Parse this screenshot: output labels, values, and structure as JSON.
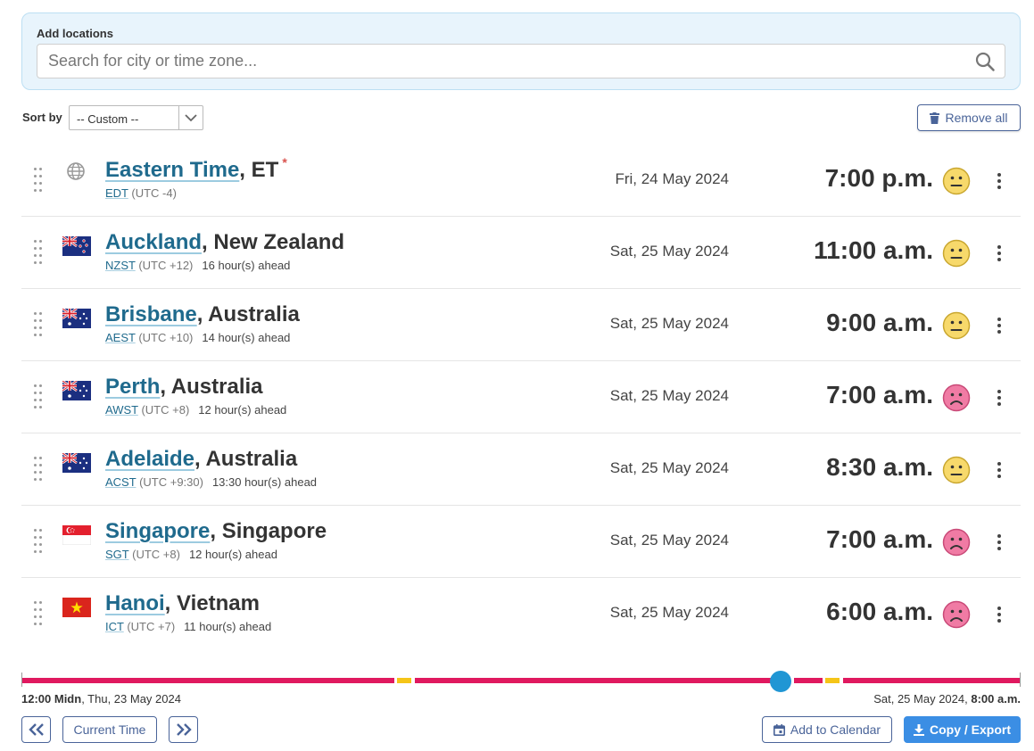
{
  "search": {
    "label": "Add locations",
    "placeholder": "Search for city or time zone...",
    "value": ""
  },
  "sort": {
    "label": "Sort by",
    "selected": "-- Custom --"
  },
  "toolbar": {
    "remove_all_label": "Remove all"
  },
  "locations": [
    {
      "city": "Eastern Time",
      "region": ", ET",
      "star": "*",
      "abbr": "EDT",
      "utc": "(UTC -4)",
      "ahead": "",
      "date": "Fri, 24 May 2024",
      "time": "7:00 p.m.",
      "mood": "neutral",
      "icon": "globe-icon"
    },
    {
      "city": "Auckland",
      "region": ", New Zealand",
      "star": "",
      "abbr": "NZST",
      "utc": "(UTC +12)",
      "ahead": "16 hour(s) ahead",
      "date": "Sat, 25 May 2024",
      "time": "11:00 a.m.",
      "mood": "neutral",
      "icon": "flag-new-zealand-icon"
    },
    {
      "city": "Brisbane",
      "region": ", Australia",
      "star": "",
      "abbr": "AEST",
      "utc": "(UTC +10)",
      "ahead": "14 hour(s) ahead",
      "date": "Sat, 25 May 2024",
      "time": "9:00 a.m.",
      "mood": "neutral",
      "icon": "flag-australia-icon"
    },
    {
      "city": "Perth",
      "region": ", Australia",
      "star": "",
      "abbr": "AWST",
      "utc": "(UTC +8)",
      "ahead": "12 hour(s) ahead",
      "date": "Sat, 25 May 2024",
      "time": "7:00 a.m.",
      "mood": "sad",
      "icon": "flag-australia-icon"
    },
    {
      "city": "Adelaide",
      "region": ", Australia",
      "star": "",
      "abbr": "ACST",
      "utc": "(UTC +9:30)",
      "ahead": "13:30 hour(s) ahead",
      "date": "Sat, 25 May 2024",
      "time": "8:30 a.m.",
      "mood": "neutral",
      "icon": "flag-australia-icon"
    },
    {
      "city": "Singapore",
      "region": ", Singapore",
      "star": "",
      "abbr": "SGT",
      "utc": "(UTC +8)",
      "ahead": "12 hour(s) ahead",
      "date": "Sat, 25 May 2024",
      "time": "7:00 a.m.",
      "mood": "sad",
      "icon": "flag-singapore-icon"
    },
    {
      "city": "Hanoi",
      "region": ", Vietnam",
      "star": "",
      "abbr": "ICT",
      "utc": "(UTC +7)",
      "ahead": "11 hour(s) ahead",
      "date": "Sat, 25 May 2024",
      "time": "6:00 a.m.",
      "mood": "sad",
      "icon": "flag-vietnam-icon"
    }
  ],
  "timeline": {
    "start_bold": "12:00 Midn",
    "start_rest": ", Thu, 23 May 2024",
    "end_rest": "Sat, 25 May 2024, ",
    "end_bold": "8:00 a.m.",
    "handle_fraction": 0.76,
    "colors": {
      "night": "#e0195f",
      "dawn": "#f5c518",
      "handle": "#2096d4"
    }
  },
  "buttons": {
    "prev_icon": "double-chevron-left-icon",
    "current_time_label": "Current Time",
    "next_icon": "double-chevron-right-icon",
    "add_calendar_label": "Add to Calendar",
    "copy_export_label": "Copy / Export"
  },
  "colors": {
    "link": "#1f6a8d",
    "button_border": "#4a6499",
    "primary": "#3b8ee4",
    "panel_bg": "#e8f4fc"
  }
}
